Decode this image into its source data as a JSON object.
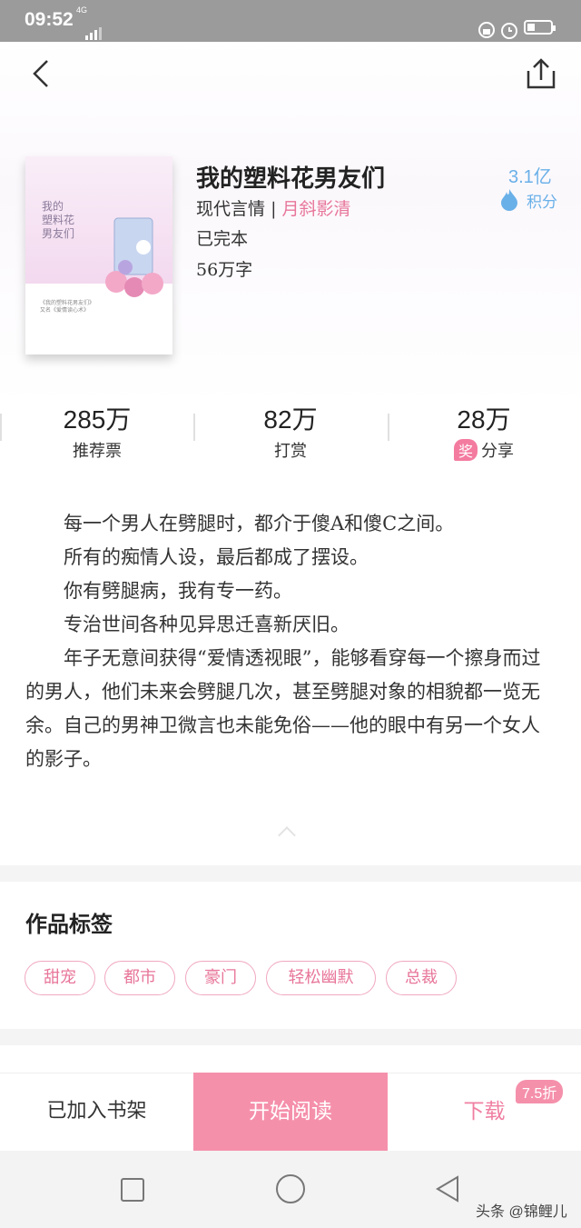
{
  "status_bar": {
    "time": "09:52",
    "network": "4G"
  },
  "book": {
    "title": "我的塑料花男友们",
    "genre": "现代言情",
    "separator": "|",
    "author": "月斜影清",
    "status": "已完本",
    "word_count": "56万字",
    "score": "3.1亿",
    "score_label": "积分",
    "cover": {
      "title_line1": "我的",
      "title_line2": "塑料花",
      "title_line3": "男友们",
      "caption1": "《我的塑料花男友们》",
      "caption2": "又名《爱情读心术》"
    }
  },
  "stats": [
    {
      "value": "285万",
      "label": "推荐票"
    },
    {
      "value": "82万",
      "label": "打赏"
    },
    {
      "value": "28万",
      "label": "分享",
      "badge": "奖"
    }
  ],
  "description": [
    "每一个男人在劈腿时，都介于傻A和傻C之间。",
    "所有的痴情人设，最后都成了摆设。",
    "你有劈腿病，我有专一药。",
    "专治世间各种见异思迁喜新厌旧。",
    "年子无意间获得“爱情透视眼”，能够看穿每一个擦身而过的男人，他们未来会劈腿几次，甚至劈腿对象的相貌都一览无余。自己的男神卫微言也未能免俗——他的眼中有另一个女人的影子。"
  ],
  "tags_section": {
    "title": "作品标签",
    "tags": [
      "甜宠",
      "都市",
      "豪门",
      "轻松幽默",
      "总裁"
    ]
  },
  "bottom_bar": {
    "shelf": "已加入书架",
    "read": "开始阅读",
    "download": "下载",
    "discount": "7.5折"
  },
  "watermark": "头条 @锦鲤儿",
  "colors": {
    "accent": "#f590ab",
    "score_blue": "#6ab0e8",
    "status_bar": "#9b9b9b"
  }
}
